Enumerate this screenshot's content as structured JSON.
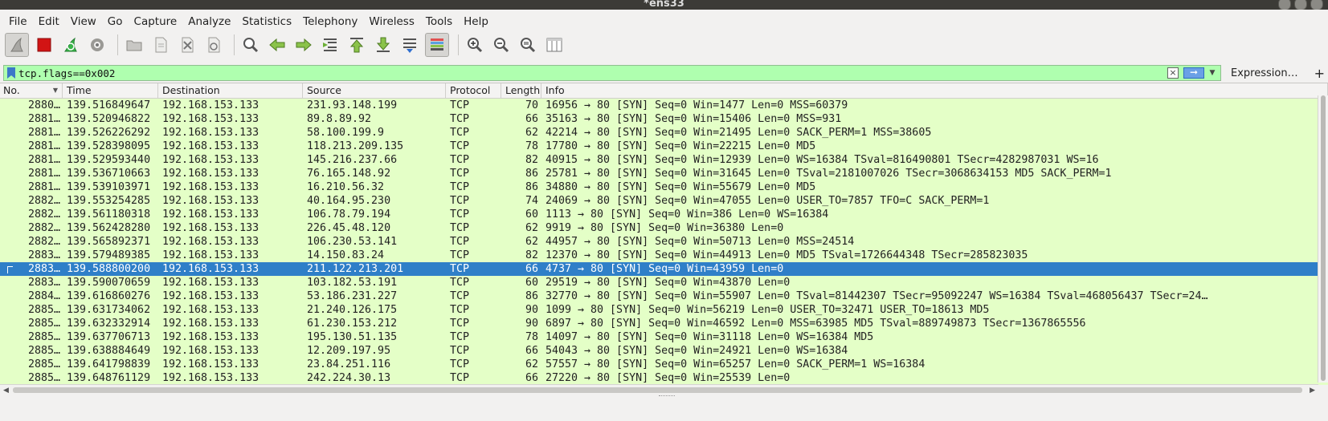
{
  "window": {
    "title": "*ens33"
  },
  "menubar": [
    "File",
    "Edit",
    "View",
    "Go",
    "Capture",
    "Analyze",
    "Statistics",
    "Telephony",
    "Wireless",
    "Tools",
    "Help"
  ],
  "toolbar": {
    "icons": [
      "shark-fin-start-icon",
      "stop-square-icon",
      "restart-fin-icon",
      "capture-options-gear-icon",
      "open-folder-icon",
      "save-file-icon",
      "close-file-icon",
      "reload-icon",
      "find-magnifier-icon",
      "go-back-arrow-icon",
      "go-forward-arrow-icon",
      "go-to-packet-icon",
      "go-first-packet-icon",
      "go-last-packet-icon",
      "autoscroll-icon",
      "colorize-icon",
      "zoom-in-icon",
      "zoom-out-icon",
      "zoom-normal-icon",
      "resize-columns-icon"
    ]
  },
  "filter": {
    "value": "tcp.flags==0x002",
    "expression_label": "Expression…",
    "plus_label": "+",
    "colors": {
      "valid": "#afffaf"
    }
  },
  "columns": [
    "No.",
    "Time",
    "Destination",
    "Source",
    "Protocol",
    "Length",
    "Info"
  ],
  "colors": {
    "row_bg": "#e4ffc7",
    "selected_bg": "#2f7fc8"
  },
  "selected_index": 12,
  "packets": [
    {
      "no": "2880…",
      "time": "139.516849647",
      "dst": "192.168.153.133",
      "src": "231.93.148.199",
      "proto": "TCP",
      "len": "70",
      "info": "16956 → 80 [SYN] Seq=0 Win=1477 Len=0 MSS=60379"
    },
    {
      "no": "2881…",
      "time": "139.520946822",
      "dst": "192.168.153.133",
      "src": "89.8.89.92",
      "proto": "TCP",
      "len": "66",
      "info": "35163 → 80 [SYN] Seq=0 Win=15406 Len=0 MSS=931"
    },
    {
      "no": "2881…",
      "time": "139.526226292",
      "dst": "192.168.153.133",
      "src": "58.100.199.9",
      "proto": "TCP",
      "len": "62",
      "info": "42214 → 80 [SYN] Seq=0 Win=21495 Len=0 SACK_PERM=1 MSS=38605"
    },
    {
      "no": "2881…",
      "time": "139.528398095",
      "dst": "192.168.153.133",
      "src": "118.213.209.135",
      "proto": "TCP",
      "len": "78",
      "info": "17780 → 80 [SYN] Seq=0 Win=22215 Len=0 MD5"
    },
    {
      "no": "2881…",
      "time": "139.529593440",
      "dst": "192.168.153.133",
      "src": "145.216.237.66",
      "proto": "TCP",
      "len": "82",
      "info": "40915 → 80 [SYN] Seq=0 Win=12939 Len=0 WS=16384 TSval=816490801 TSecr=4282987031 WS=16"
    },
    {
      "no": "2881…",
      "time": "139.536710663",
      "dst": "192.168.153.133",
      "src": "76.165.148.92",
      "proto": "TCP",
      "len": "86",
      "info": "25781 → 80 [SYN] Seq=0 Win=31645 Len=0 TSval=2181007026 TSecr=3068634153 MD5 SACK_PERM=1"
    },
    {
      "no": "2881…",
      "time": "139.539103971",
      "dst": "192.168.153.133",
      "src": "16.210.56.32",
      "proto": "TCP",
      "len": "86",
      "info": "34880 → 80 [SYN] Seq=0 Win=55679 Len=0 MD5"
    },
    {
      "no": "2882…",
      "time": "139.553254285",
      "dst": "192.168.153.133",
      "src": "40.164.95.230",
      "proto": "TCP",
      "len": "74",
      "info": "24069 → 80 [SYN] Seq=0 Win=47055 Len=0 USER_TO=7857 TFO=C SACK_PERM=1"
    },
    {
      "no": "2882…",
      "time": "139.561180318",
      "dst": "192.168.153.133",
      "src": "106.78.79.194",
      "proto": "TCP",
      "len": "60",
      "info": "1113 → 80 [SYN] Seq=0 Win=386 Len=0 WS=16384"
    },
    {
      "no": "2882…",
      "time": "139.562428280",
      "dst": "192.168.153.133",
      "src": "226.45.48.120",
      "proto": "TCP",
      "len": "62",
      "info": "9919 → 80 [SYN] Seq=0 Win=36380 Len=0"
    },
    {
      "no": "2882…",
      "time": "139.565892371",
      "dst": "192.168.153.133",
      "src": "106.230.53.141",
      "proto": "TCP",
      "len": "62",
      "info": "44957 → 80 [SYN] Seq=0 Win=50713 Len=0 MSS=24514"
    },
    {
      "no": "2883…",
      "time": "139.579489385",
      "dst": "192.168.153.133",
      "src": "14.150.83.24",
      "proto": "TCP",
      "len": "82",
      "info": "12370 → 80 [SYN] Seq=0 Win=44913 Len=0 MD5 TSval=1726644348 TSecr=285823035"
    },
    {
      "no": "2883…",
      "time": "139.588800200",
      "dst": "192.168.153.133",
      "src": "211.122.213.201",
      "proto": "TCP",
      "len": "66",
      "info": "4737 → 80 [SYN] Seq=0 Win=43959 Len=0"
    },
    {
      "no": "2883…",
      "time": "139.590070659",
      "dst": "192.168.153.133",
      "src": "103.182.53.191",
      "proto": "TCP",
      "len": "60",
      "info": "29519 → 80 [SYN] Seq=0 Win=43870 Len=0"
    },
    {
      "no": "2884…",
      "time": "139.616860276",
      "dst": "192.168.153.133",
      "src": "53.186.231.227",
      "proto": "TCP",
      "len": "86",
      "info": "32770 → 80 [SYN] Seq=0 Win=55907 Len=0 TSval=81442307 TSecr=95092247 WS=16384 TSval=468056437 TSecr=24…"
    },
    {
      "no": "2885…",
      "time": "139.631734062",
      "dst": "192.168.153.133",
      "src": "21.240.126.175",
      "proto": "TCP",
      "len": "90",
      "info": "1099 → 80 [SYN] Seq=0 Win=56219 Len=0 USER_TO=32471 USER_TO=18613 MD5"
    },
    {
      "no": "2885…",
      "time": "139.632332914",
      "dst": "192.168.153.133",
      "src": "61.230.153.212",
      "proto": "TCP",
      "len": "90",
      "info": "6897 → 80 [SYN] Seq=0 Win=46592 Len=0 MSS=63985 MD5 TSval=889749873 TSecr=1367865556"
    },
    {
      "no": "2885…",
      "time": "139.637706713",
      "dst": "192.168.153.133",
      "src": "195.130.51.135",
      "proto": "TCP",
      "len": "78",
      "info": "14097 → 80 [SYN] Seq=0 Win=31118 Len=0 WS=16384 MD5"
    },
    {
      "no": "2885…",
      "time": "139.638884649",
      "dst": "192.168.153.133",
      "src": "12.209.197.95",
      "proto": "TCP",
      "len": "66",
      "info": "54043 → 80 [SYN] Seq=0 Win=24921 Len=0 WS=16384"
    },
    {
      "no": "2885…",
      "time": "139.641798839",
      "dst": "192.168.153.133",
      "src": "23.84.251.116",
      "proto": "TCP",
      "len": "62",
      "info": "57557 → 80 [SYN] Seq=0 Win=65257 Len=0 SACK_PERM=1 WS=16384"
    },
    {
      "no": "2885…",
      "time": "139.648761129",
      "dst": "192.168.153.133",
      "src": "242.224.30.13",
      "proto": "TCP",
      "len": "66",
      "info": "27220 → 80 [SYN] Seq=0 Win=25539 Len=0"
    }
  ]
}
